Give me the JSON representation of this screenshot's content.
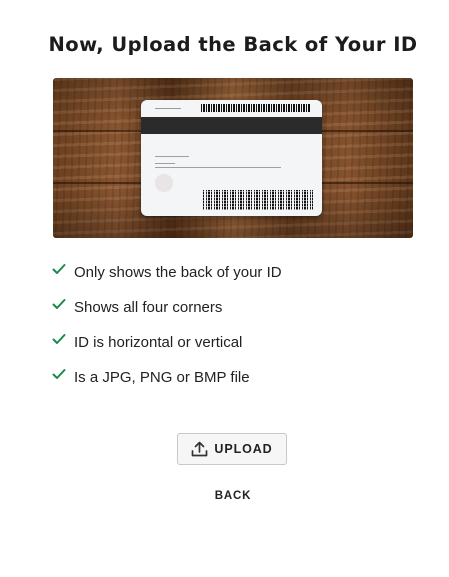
{
  "page": {
    "title": "Now, Upload the Back of Your ID"
  },
  "image": {
    "icon": "id-card-back-photo"
  },
  "checklist": {
    "icon": "checkmark-icon",
    "check_color": "#1a8a4a",
    "items": [
      {
        "label": "Only shows the back of your ID"
      },
      {
        "label": "Shows all four corners"
      },
      {
        "label": "ID is horizontal or vertical"
      },
      {
        "label": "Is a JPG, PNG or BMP file"
      }
    ]
  },
  "actions": {
    "upload_icon": "upload-icon",
    "upload_label": "UPLOAD",
    "back_label": "BACK"
  }
}
